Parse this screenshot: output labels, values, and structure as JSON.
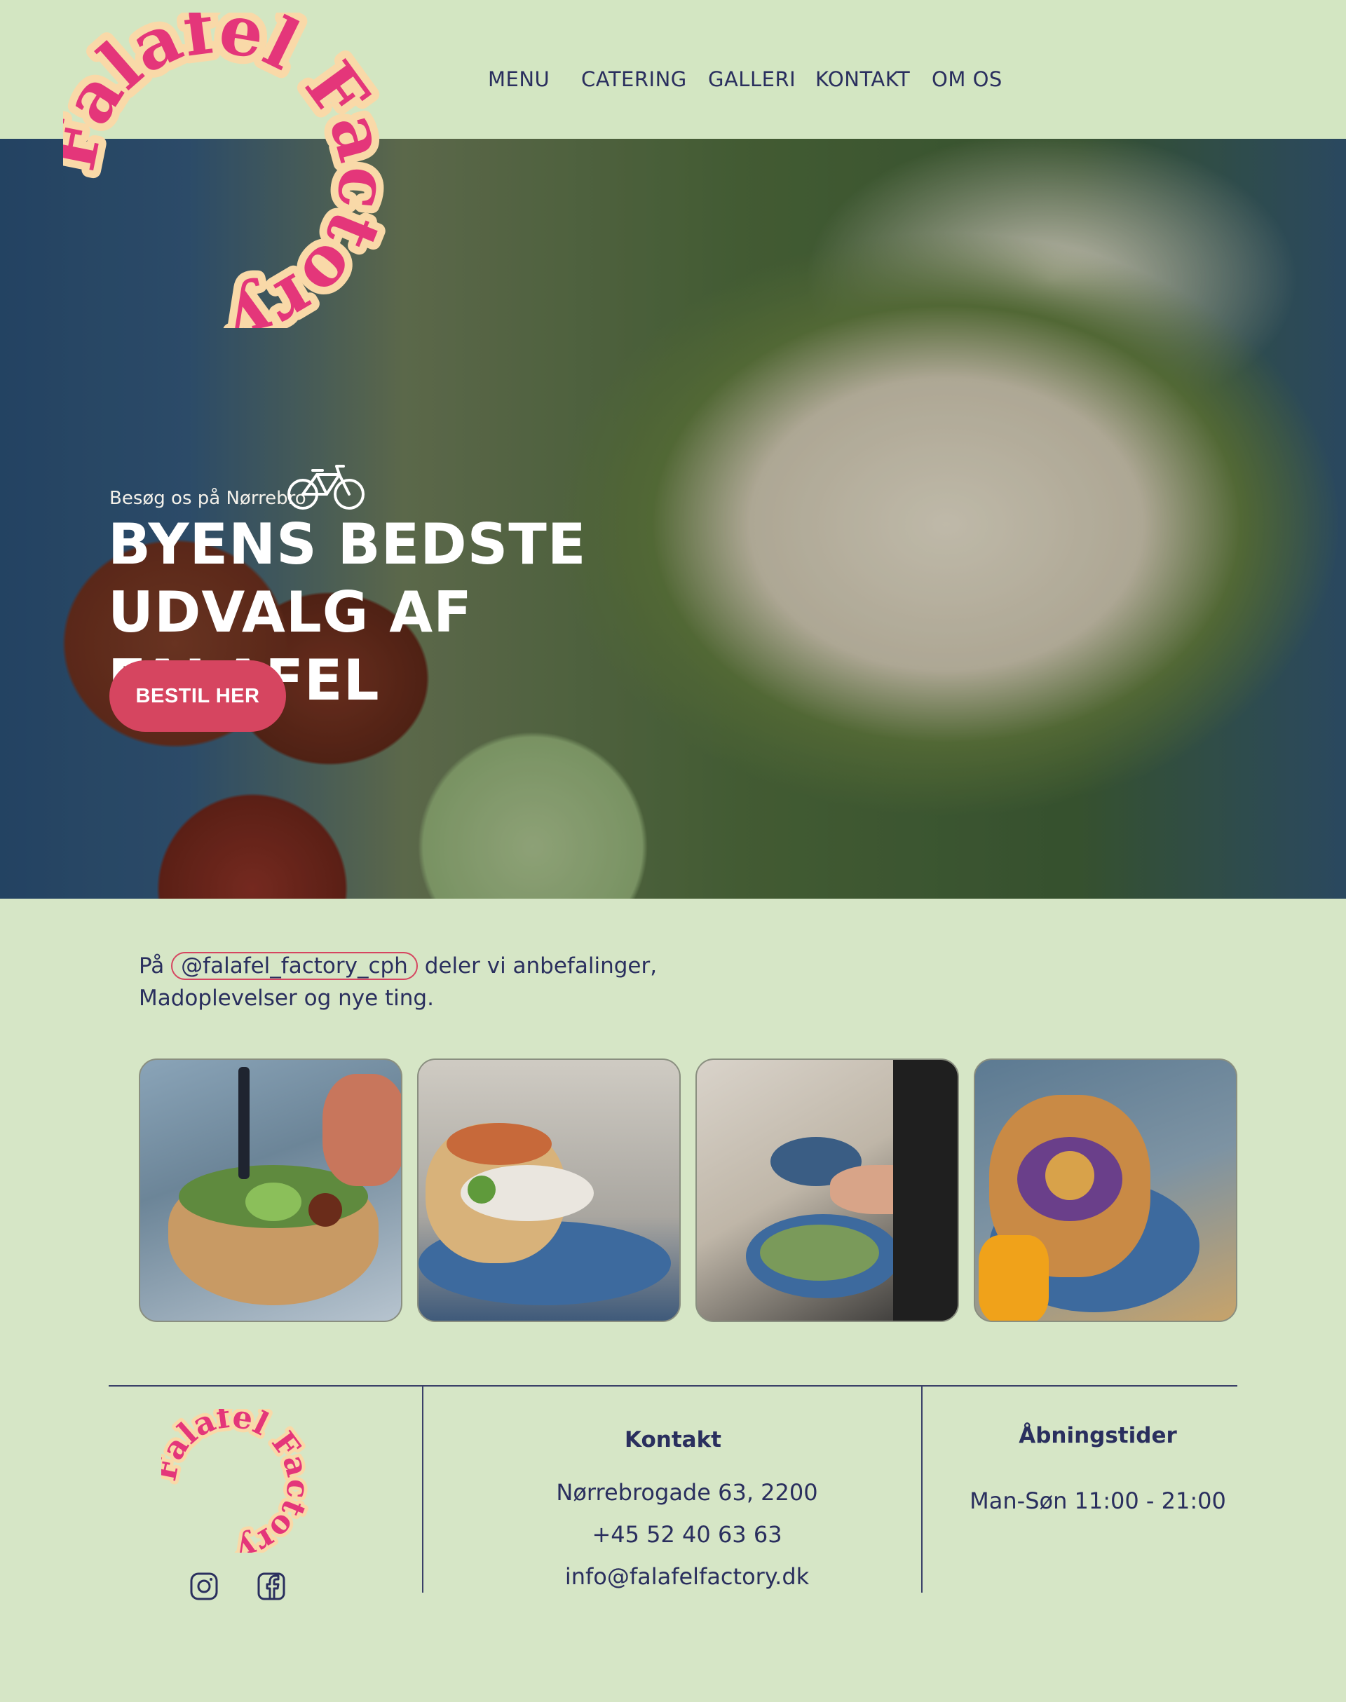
{
  "brand": {
    "name_line1": "Falafel",
    "name_line2": "Factory",
    "pink": "#e4367a",
    "peach": "#f9d9a8",
    "navy": "#2a2f5e",
    "green_bg": "#d6e6c6",
    "accent_red": "#d64560"
  },
  "nav": {
    "items": [
      {
        "label": "MENU"
      },
      {
        "label": "CATERING"
      },
      {
        "label": "GALLERI"
      },
      {
        "label": "KONTAKT"
      },
      {
        "label": "OM OS"
      }
    ]
  },
  "hero": {
    "subtitle": "Besøg os på Nørrebro",
    "title_line1": "BYENS BEDSTE",
    "title_line2": "UDVALG AF FALAFEL",
    "cta_label": "BESTIL HER",
    "icon": "bicycle-icon"
  },
  "instagram": {
    "prefix": "På",
    "handle": "@falafel_factory_cph",
    "suffix": "deler vi anbefalinger,",
    "line2": "Madoplevelser og nye ting.",
    "images": [
      {
        "name": "bowl-photo"
      },
      {
        "name": "pita-photo"
      },
      {
        "name": "table-photo"
      },
      {
        "name": "burger-photo"
      }
    ]
  },
  "footer": {
    "social": [
      {
        "icon": "instagram-icon"
      },
      {
        "icon": "facebook-icon"
      }
    ],
    "contact": {
      "heading": "Kontakt",
      "address": "Nørrebrogade 63, 2200",
      "phone": "+45 52 40 63 63",
      "email": "info@falafelfactory.dk"
    },
    "hours": {
      "heading": "Åbningstider",
      "text": "Man-Søn 11:00 - 21:00"
    }
  }
}
